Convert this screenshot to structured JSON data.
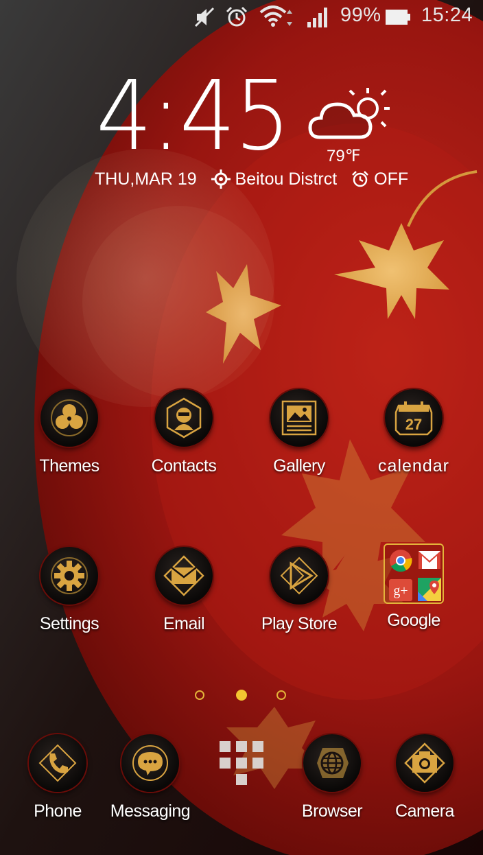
{
  "status_bar": {
    "icons": [
      "mute-icon",
      "alarm-icon",
      "wifi-icon",
      "signal-icon",
      "battery-icon"
    ],
    "battery": "99%",
    "time": "15:24"
  },
  "clock_widget": {
    "time": "4:45",
    "weather_icon": "partly-cloudy-icon",
    "temperature": "79℉",
    "date": "THU,MAR 19",
    "location": "Beitou Distrct",
    "alarm": "OFF"
  },
  "apps": [
    {
      "label": "Themes",
      "icon": "themes-icon"
    },
    {
      "label": "Contacts",
      "icon": "contacts-icon"
    },
    {
      "label": "Gallery",
      "icon": "gallery-icon"
    },
    {
      "label": "calendar",
      "icon": "calendar-icon",
      "badge": "27"
    },
    {
      "label": "Settings",
      "icon": "settings-icon"
    },
    {
      "label": "Email",
      "icon": "email-icon"
    },
    {
      "label": "Play Store",
      "icon": "play-store-icon"
    },
    {
      "label": "Google",
      "icon": "google-folder",
      "folder_apps": [
        "chrome",
        "gmail",
        "google-plus",
        "maps"
      ],
      "folder_text": "g+"
    }
  ],
  "page_indicator": {
    "pages": 3,
    "current": 2
  },
  "dock": [
    {
      "label": "Phone",
      "icon": "phone-icon"
    },
    {
      "label": "Messaging",
      "icon": "messaging-icon"
    },
    {
      "label": "",
      "icon": "app-drawer-icon"
    },
    {
      "label": "Browser",
      "icon": "browser-icon"
    },
    {
      "label": "Camera",
      "icon": "camera-icon"
    }
  ],
  "colors": {
    "accent": "#d9a441",
    "wallpaper": "#9c1510"
  }
}
